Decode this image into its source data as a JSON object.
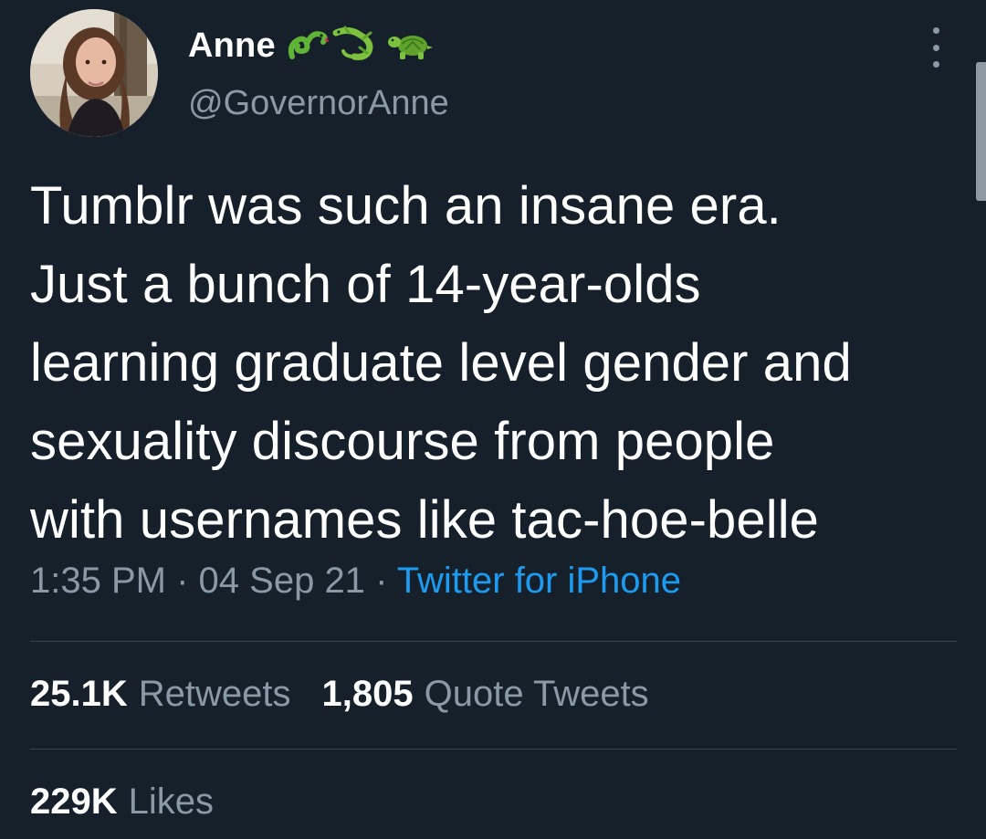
{
  "author": {
    "display_name": "Anne",
    "emojis": [
      "snake-emoji",
      "lizard-emoji",
      "turtle-emoji"
    ],
    "handle": "@GovernorAnne"
  },
  "tweet": {
    "lines": [
      "Tumblr was such an insane era.",
      "Just a bunch of 14-year-olds",
      "learning graduate level gender and",
      "sexuality discourse from people",
      "with usernames like tac-hoe-belle"
    ],
    "time": "1:35 PM",
    "separator": "·",
    "date": "04 Sep 21",
    "source": "Twitter for iPhone"
  },
  "stats": {
    "retweets_count": "25.1K",
    "retweets_label": "Retweets",
    "quotes_count": "1,805",
    "quotes_label": "Quote Tweets",
    "likes_count": "229K",
    "likes_label": "Likes"
  },
  "colors": {
    "background": "#15202b",
    "primary_text": "#ffffff",
    "secondary_text": "#8b98a5",
    "link": "#1d9bf0",
    "divider": "#38444d"
  }
}
